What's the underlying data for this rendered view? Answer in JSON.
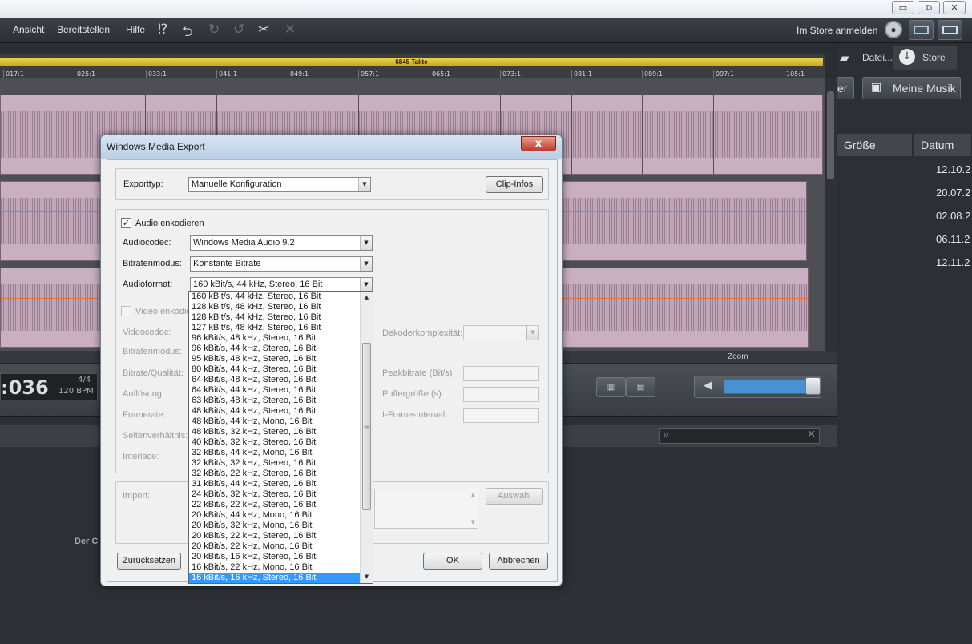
{
  "menu": {
    "items": [
      "Ansicht",
      "Bereitstellen",
      "Hilfe"
    ],
    "store_login": "Im Store anmelden"
  },
  "window_buttons": {
    "minimize": "▭",
    "restore": "⧉",
    "close": "✕"
  },
  "arranger": {
    "takte_label": "6845 Takte",
    "ruler": [
      "017:1",
      "025:1",
      "033:1",
      "041:1",
      "049:1",
      "057:1",
      "065:1",
      "073:1",
      "081:1",
      "089:1",
      "097:1",
      "105:1"
    ],
    "zoom_label": "Zoom"
  },
  "transport": {
    "timecode": ":036",
    "signature": "4/4",
    "bpm": "120 BPM"
  },
  "right_panel": {
    "tabs": [
      "Datei...",
      "Store"
    ],
    "partial_button": "er",
    "my_music": "Meine Musik",
    "columns": [
      "Größe",
      "Datum"
    ],
    "dates": [
      "12.10.2",
      "20.07.2",
      "02.08.2",
      "06.11.2",
      "12.11.2"
    ]
  },
  "lower": {
    "partial_text": "Der C"
  },
  "dialog": {
    "title": "Windows Media Export",
    "close": "x",
    "export_type_label": "Exporttyp:",
    "export_type_value": "Manuelle Konfiguration",
    "clip_info_button": "Clip-Infos",
    "audio_encode_label": "Audio enkodieren",
    "audio_codec_label": "Audiocodec:",
    "audio_codec_value": "Windows Media Audio 9.2",
    "bitrate_mode_label": "Bitratenmodus:",
    "bitrate_mode_value": "Konstante Bitrate",
    "audio_format_label": "Audioformat:",
    "audio_format_value": "160 kBit/s, 44 kHz, Stereo, 16 Bit",
    "video_encode_label": "Video enkodie",
    "video_codec_label": "Videocodec:",
    "video_bitrate_mode_label": "Bitratenmodus:",
    "bitrate_quality_label": "Bitrate/Qualität:",
    "resolution_label": "Auflösung:",
    "framerate_label": "Framerate:",
    "aspect_label": "Seitenverhältnis:",
    "interlace_label": "Interlace:",
    "decoder_complexity_label": "Dekoderkomplexität:",
    "peak_bitrate_label": "Peakbitrate (Bit/s)",
    "buffer_size_label": "Puffergröße (s):",
    "iframe_interval_label": "I-Frame-Intervall:",
    "import_label": "Import:",
    "select_button": "Auswahl",
    "reset_button": "Zurücksetzen",
    "ok_button": "OK",
    "cancel_button": "Abbrechen"
  },
  "audio_format_options": [
    "160 kBit/s, 44 kHz, Stereo, 16 Bit",
    "128 kBit/s, 48 kHz, Stereo, 16 Bit",
    "128 kBit/s, 44 kHz, Stereo, 16 Bit",
    "127 kBit/s, 48 kHz, Stereo, 16 Bit",
    "96 kBit/s, 48 kHz, Stereo, 16 Bit",
    "96 kBit/s, 44 kHz, Stereo, 16 Bit",
    "95 kBit/s, 48 kHz, Stereo, 16 Bit",
    "80 kBit/s, 44 kHz, Stereo, 16 Bit",
    "64 kBit/s, 48 kHz, Stereo, 16 Bit",
    "64 kBit/s, 44 kHz, Stereo, 16 Bit",
    "63 kBit/s, 48 kHz, Stereo, 16 Bit",
    "48 kBit/s, 44 kHz, Stereo, 16 Bit",
    "48 kBit/s, 44 kHz, Mono, 16 Bit",
    "48 kBit/s, 32 kHz, Stereo, 16 Bit",
    "40 kBit/s, 32 kHz, Stereo, 16 Bit",
    "32 kBit/s, 44 kHz, Mono, 16 Bit",
    "32 kBit/s, 32 kHz, Stereo, 16 Bit",
    "32 kBit/s, 22 kHz, Stereo, 16 Bit",
    "31 kBit/s, 44 kHz, Stereo, 16 Bit",
    "24 kBit/s, 32 kHz, Stereo, 16 Bit",
    "22 kBit/s, 22 kHz, Stereo, 16 Bit",
    "20 kBit/s, 44 kHz, Mono, 16 Bit",
    "20 kBit/s, 32 kHz, Mono, 16 Bit",
    "20 kBit/s, 22 kHz, Stereo, 16 Bit",
    "20 kBit/s, 22 kHz, Mono, 16 Bit",
    "20 kBit/s, 16 kHz, Stereo, 16 Bit",
    "16 kBit/s, 22 kHz, Mono, 16 Bit",
    "16 kBit/s, 16 kHz, Stereo, 16 Bit"
  ],
  "selected_option_index": 27,
  "colors": {
    "selection": "#3399ff",
    "takte_bar": "#e8c52e",
    "wave": "#c9afc0",
    "volume": "#4a91d4"
  }
}
